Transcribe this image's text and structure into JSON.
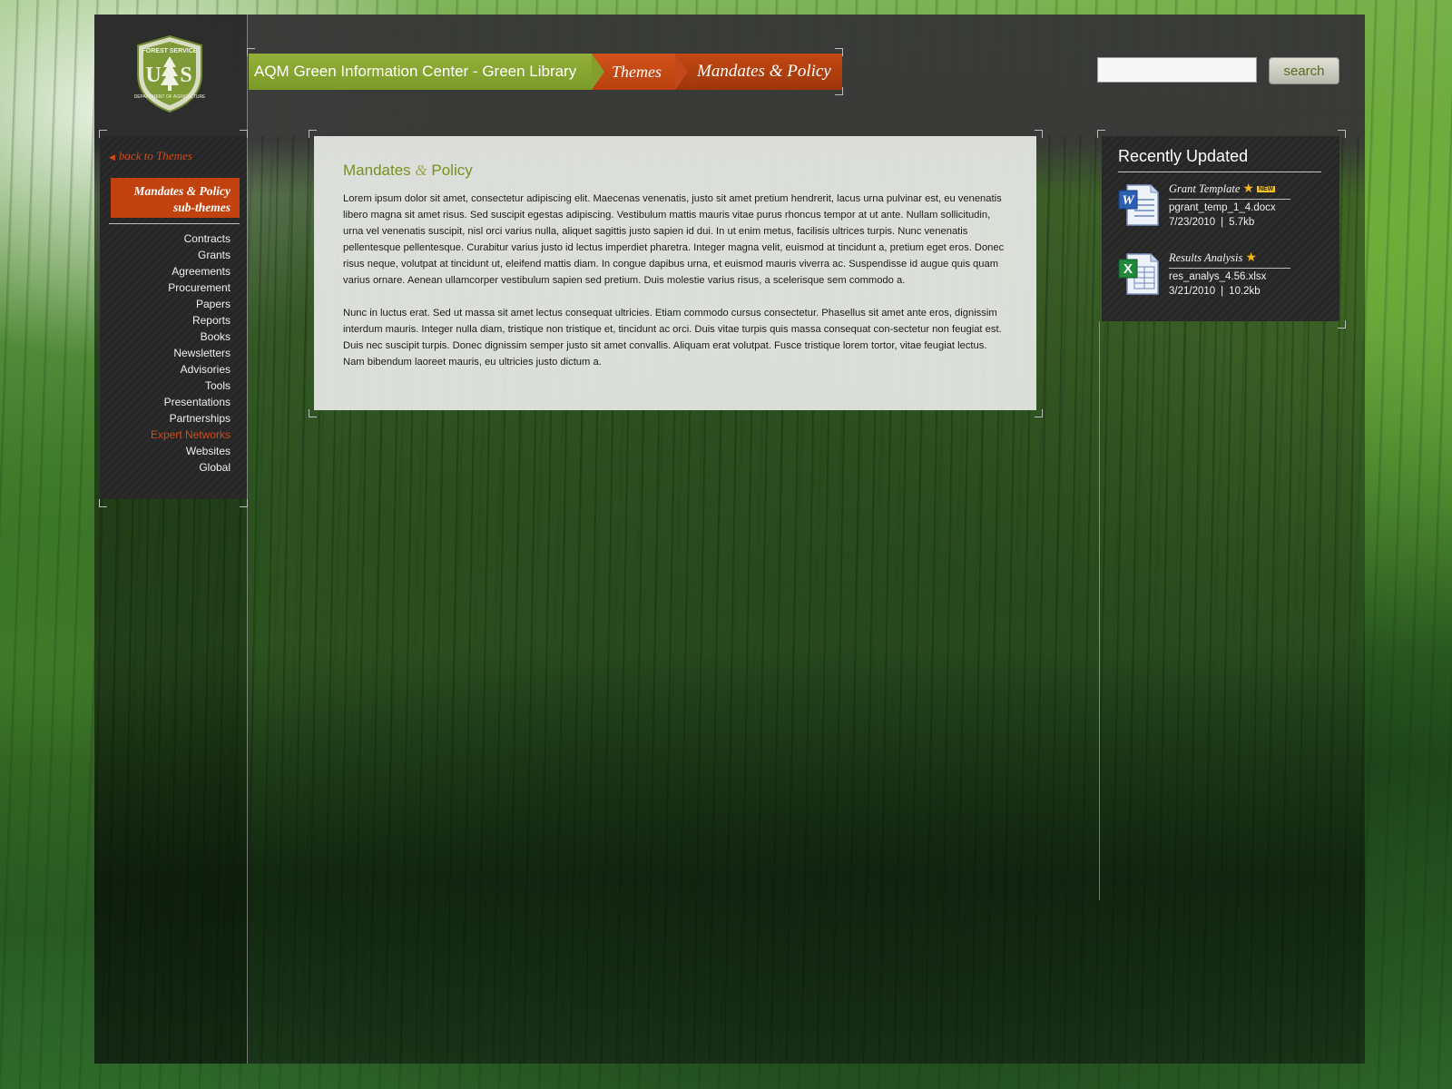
{
  "header": {
    "logo_alt": "FOREST SERVICE U.S. DEPARTMENT OF AGRICULTURE",
    "breadcrumb": [
      {
        "label": "AQM Green Information Center - Green Library"
      },
      {
        "label": "Themes"
      },
      {
        "label": "Mandates & Policy"
      }
    ],
    "search": {
      "placeholder": "",
      "value": "",
      "button_label": "search"
    }
  },
  "sidebar": {
    "back_link": "back to Themes",
    "subtheme_title_line1": "Mandates & Policy",
    "subtheme_title_line2": "sub-themes",
    "items": [
      {
        "label": "Contracts"
      },
      {
        "label": "Grants"
      },
      {
        "label": "Agreements"
      },
      {
        "label": "Procurement"
      },
      {
        "label": "Papers"
      },
      {
        "label": "Reports"
      },
      {
        "label": "Books"
      },
      {
        "label": "Newsletters"
      },
      {
        "label": "Advisories"
      },
      {
        "label": "Tools"
      },
      {
        "label": "Presentations"
      },
      {
        "label": "Partnerships"
      },
      {
        "label": "Expert Networks",
        "active": true
      },
      {
        "label": "Websites"
      },
      {
        "label": "Global"
      }
    ]
  },
  "main": {
    "title_a": "Mandates",
    "title_amp": "&",
    "title_b": "Policy",
    "paragraphs": [
      "Lorem ipsum dolor sit amet, consectetur adipiscing elit. Maecenas venenatis, justo sit amet pretium hendrerit, lacus urna pulvinar est, eu venenatis libero magna sit amet risus. Sed suscipit egestas adipiscing. Vestibulum mattis mauris vitae purus rhoncus tempor at ut ante. Nullam sollicitudin, urna vel venenatis suscipit, nisl orci varius nulla, aliquet sagittis justo sapien id dui. In ut enim metus, facilisis ultrices turpis. Nunc venenatis pellentesque pellentesque. Curabitur varius justo id lectus imperdiet pharetra. Integer magna velit, euismod at tincidunt a, pretium eget eros. Donec risus neque, volutpat at tincidunt ut, eleifend mattis diam. In congue dapibus urna, et euismod mauris viverra ac. Suspendisse id augue quis quam varius ornare. Aenean ullamcorper vestibulum sapien sed pretium. Duis molestie varius risus, a scelerisque sem commodo a.",
      "Nunc in luctus erat. Sed ut massa sit amet lectus consequat ultricies. Etiam commodo cursus consectetur. Phasellus sit amet ante eros, dignissim interdum mauris. Integer nulla diam, tristique non tristique et, tincidunt ac orci. Duis vitae turpis quis massa consequat con-sectetur non feugiat est. Duis nec suscipit turpis. Donec dignissim semper justo sit amet convallis. Aliquam erat volutpat. Fusce tristique lorem tortor, vitae feugiat lectus. Nam bibendum laoreet mauris, eu ultricies justo dictum a."
    ]
  },
  "recent": {
    "title": "Recently Updated",
    "items": [
      {
        "name": "Grant Template",
        "new_label": "NEW",
        "file": "pgrant_temp_1_4.docx",
        "date": "7/23/2010",
        "size": "5.7kb",
        "icon": "word-doc-icon"
      },
      {
        "name": "Results Analysis",
        "new_label": "",
        "file": "res_analys_4.56.xlsx",
        "date": "3/21/2010",
        "size": "10.2kb",
        "icon": "excel-doc-icon"
      }
    ]
  },
  "colors": {
    "accent_orange": "#c2420f",
    "accent_green": "#7a8f21",
    "frame_dark": "#373737"
  }
}
